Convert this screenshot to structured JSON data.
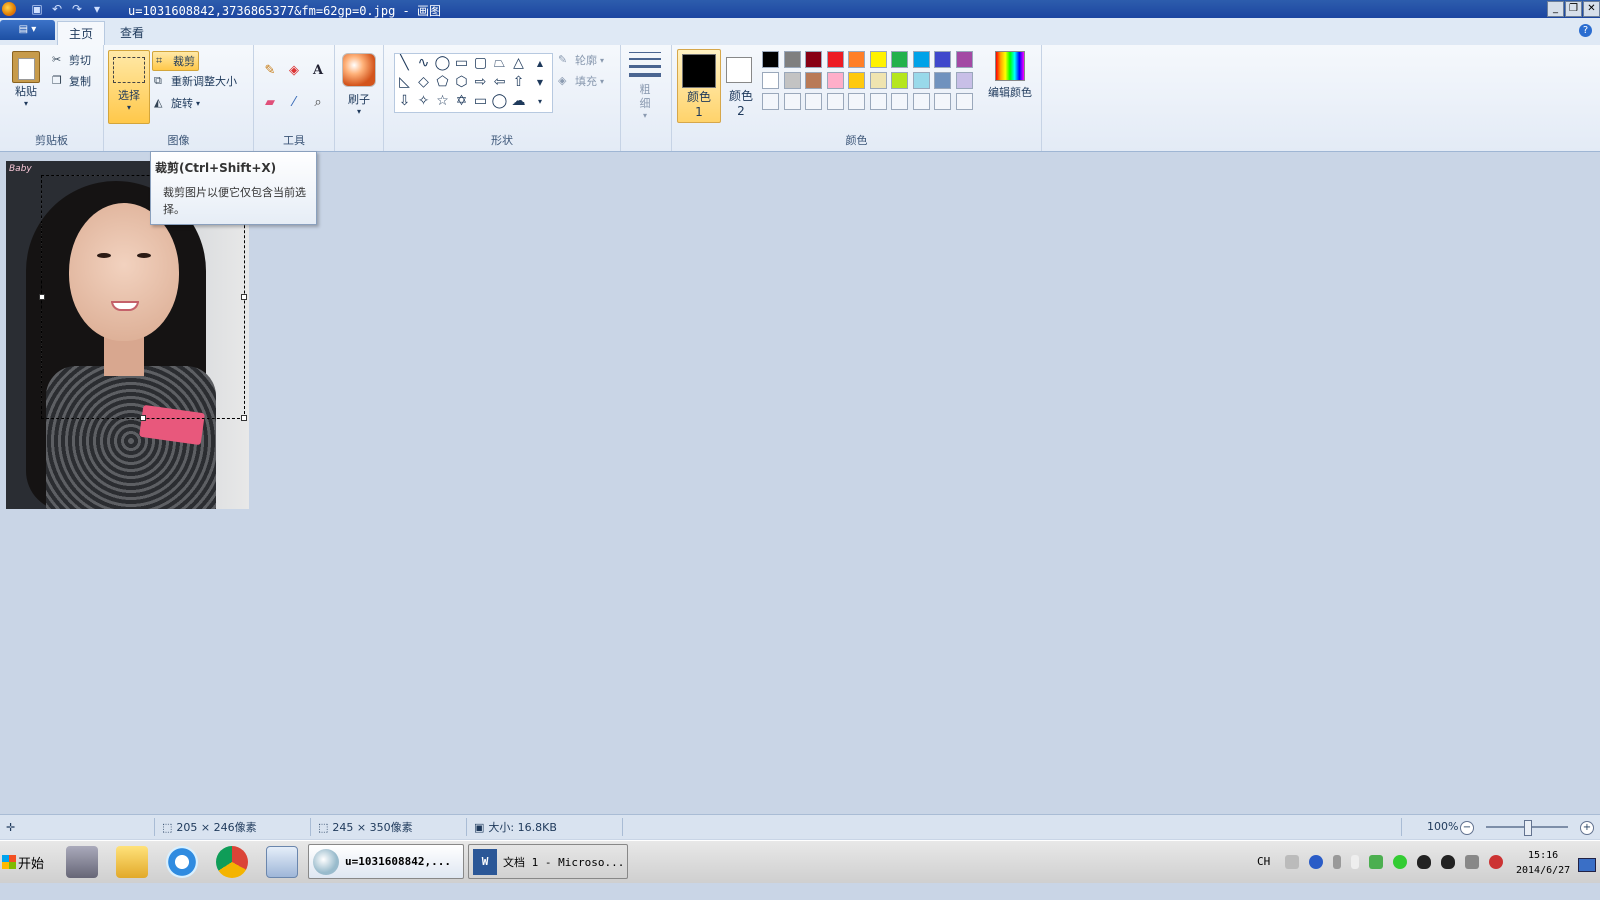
{
  "window": {
    "title": "u=1031608842,3736865377&fm=62gp=0.jpg - 画图",
    "controls": [
      "minimize",
      "restore",
      "close"
    ]
  },
  "tabs": [
    {
      "label": "主页",
      "active": true
    },
    {
      "label": "查看",
      "active": false
    }
  ],
  "ribbon": {
    "clipboard": {
      "group_label": "剪贴板",
      "paste": "粘贴",
      "cut": "剪切",
      "copy": "复制"
    },
    "image": {
      "group_label": "图像",
      "select": "选择",
      "crop": "裁剪",
      "resize": "重新调整大小",
      "rotate": "旋转"
    },
    "tools": {
      "group_label": "工具",
      "items": [
        "pencil-icon",
        "fill-icon",
        "text-icon",
        "eraser-icon",
        "color-picker-icon",
        "magnifier-icon"
      ]
    },
    "brushes": {
      "label": "刷子"
    },
    "shapes": {
      "group_label": "形状",
      "outline": "轮廓",
      "fill": "填充"
    },
    "size": {
      "label": "粗细"
    },
    "colors": {
      "group_label": "颜色",
      "color1": "颜色 1",
      "color2": "颜色 2",
      "edit_colors": "编辑颜色",
      "color1_value": "#000000",
      "color2_value": "#ffffff",
      "palette_row1": [
        "#000000",
        "#7f7f7f",
        "#880015",
        "#ed1c24",
        "#ff7f27",
        "#fff200",
        "#22b14c",
        "#00a2e8",
        "#3f48cc",
        "#a349a4"
      ],
      "palette_row2": [
        "#ffffff",
        "#c3c3c3",
        "#b97a57",
        "#ffaec9",
        "#ffc90e",
        "#efe4b0",
        "#b5e61d",
        "#99d9ea",
        "#7092be",
        "#c8bfe7"
      ]
    }
  },
  "tooltip": {
    "title": "裁剪(Ctrl+Shift+X)",
    "body": "裁剪图片以便它仅包含当前选择。"
  },
  "canvas": {
    "image_logo_text": "Baby"
  },
  "statusbar": {
    "selection_size": "205 × 246像素",
    "image_size": "245 × 350像素",
    "file_size": "大小: 16.8KB",
    "zoom": "100%"
  },
  "taskbar": {
    "start": "开始",
    "tasks": [
      {
        "label": "u=1031608842,...",
        "active": true
      },
      {
        "label": "文档 1 - Microso...",
        "active": false
      }
    ],
    "lang": "CH",
    "time": "15:16",
    "date": "2014/6/27"
  }
}
